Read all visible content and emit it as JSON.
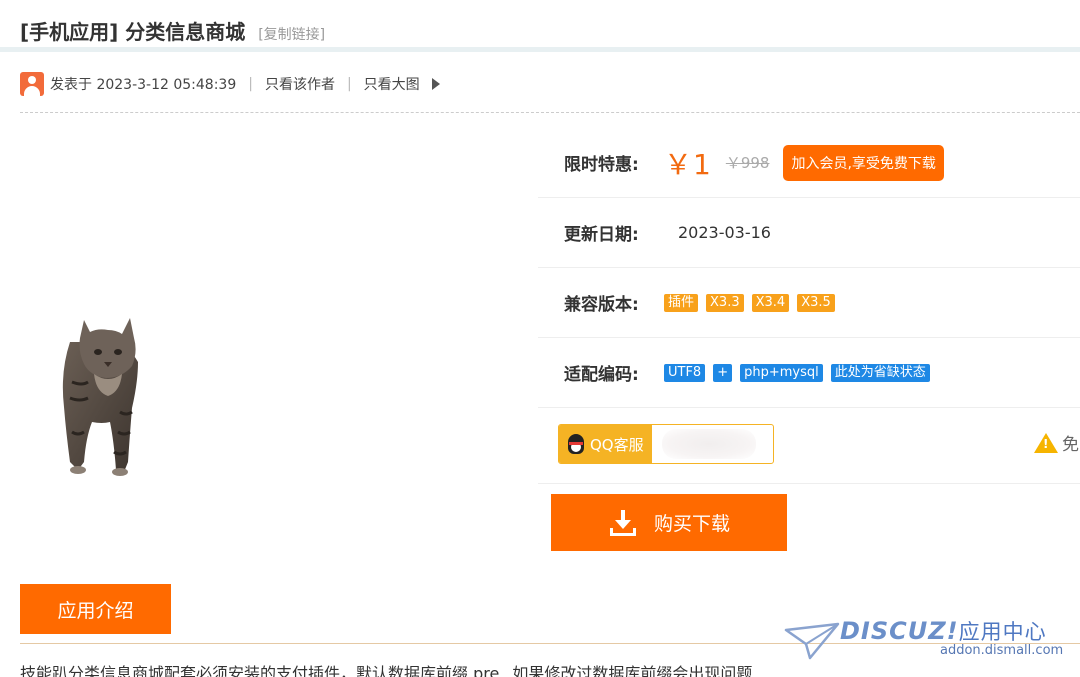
{
  "header": {
    "title": "[手机应用] 分类信息商城",
    "copy_link": "[复制链接]"
  },
  "meta": {
    "posted": "发表于 2023-3-12 05:48:39",
    "sep": "|",
    "only_author": "只看该作者",
    "big_image": "只看大图"
  },
  "product": {
    "price_label": "限时特惠:",
    "price": "￥1",
    "old_price": "￥998",
    "vip_button": "加入会员,享受免费下载",
    "update_label": "更新日期:",
    "update_date": "2023-03-16",
    "compat_label": "兼容版本:",
    "compat_tags": [
      "插件",
      "X3.3",
      "X3.4",
      "X3.5"
    ],
    "encoding_label": "适配编码:",
    "encoding_tags": [
      "UTF8",
      "+",
      "php+mysql",
      "此处为省缺状态"
    ],
    "qq_label": "QQ客服",
    "warn_text": "免",
    "buy_button": "购买下载"
  },
  "intro": {
    "tab_label": "应用介绍",
    "text": "技能趴分类信息商城配套必须安装的支付插件，默认数据库前缀 pre_ 如果修改过数据库前缀会出现问题"
  },
  "watermark": {
    "brand": "DISCUZ!",
    "brand_cn": "应用中心",
    "url": "addon.dismall.com"
  },
  "colors": {
    "accent": "#ff6a00",
    "price": "#f26a10",
    "tag_orange": "#f8a11b",
    "tag_blue": "#1e88e5",
    "qq_gold": "#f5b324"
  }
}
